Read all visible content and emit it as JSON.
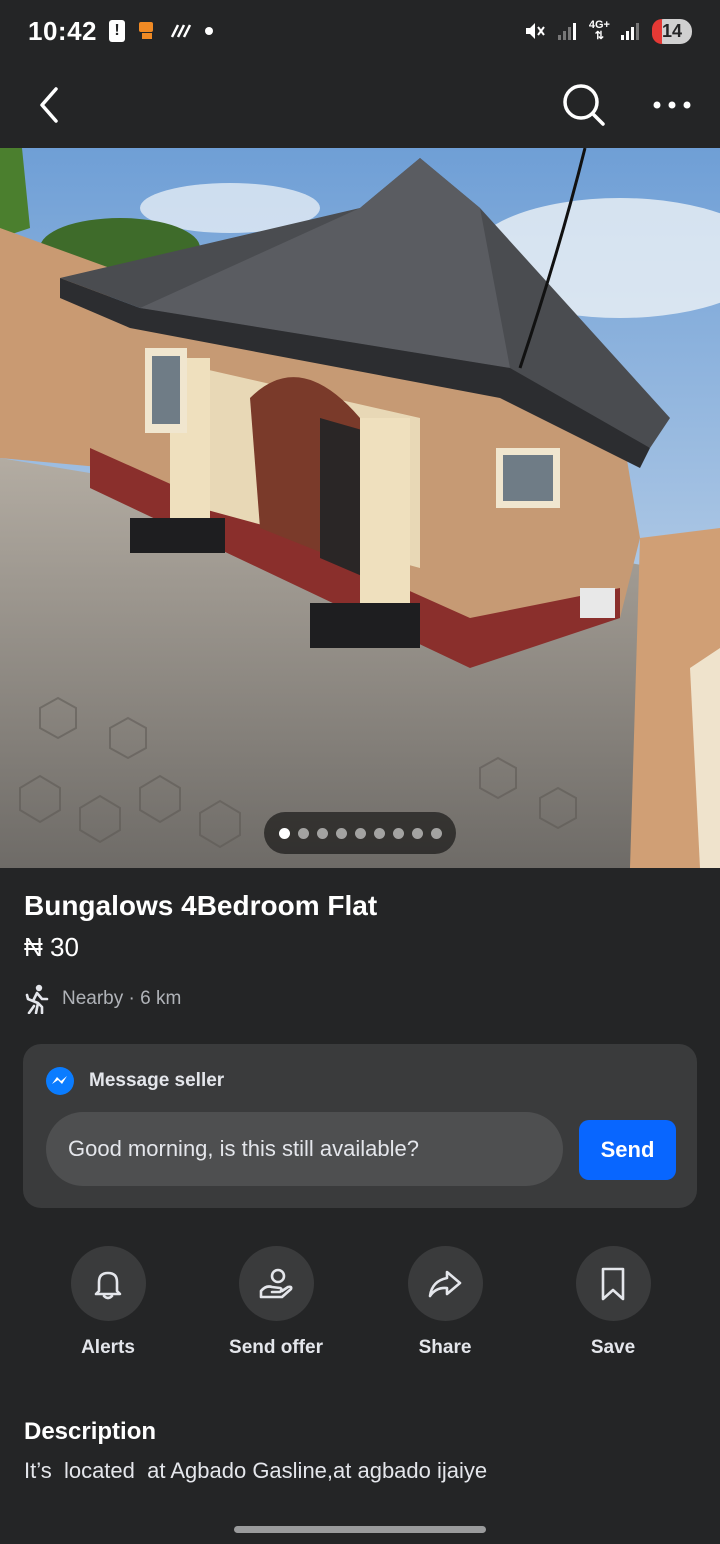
{
  "status_bar": {
    "time": "10:42",
    "network": "4G+",
    "battery": "14"
  },
  "nav": {
    "back_icon": "chevron-left-icon",
    "search_icon": "search-icon",
    "more_icon": "more-horizontal-icon"
  },
  "photo": {
    "page_count": 9,
    "active_page": 1
  },
  "listing": {
    "title": "Bungalows 4Bedroom Flat",
    "price": "₦ 30",
    "distance": "Nearby · 6 km"
  },
  "message": {
    "header": "Message seller",
    "input_value": "Good morning, is this still available?",
    "send_label": "Send",
    "accent": "#0866ff"
  },
  "actions": [
    {
      "label": "Alerts",
      "icon": "bell-icon"
    },
    {
      "label": "Send offer",
      "icon": "offer-hand-icon"
    },
    {
      "label": "Share",
      "icon": "share-arrow-icon"
    },
    {
      "label": "Save",
      "icon": "bookmark-icon"
    }
  ],
  "description": {
    "title": "Description",
    "text": "It’s  located  at Agbado Gasline,at agbado ijaiye"
  }
}
